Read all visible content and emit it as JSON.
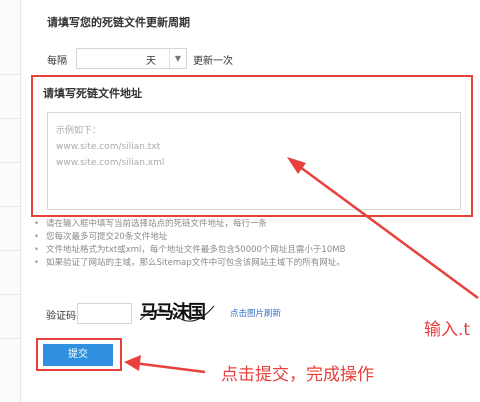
{
  "frequency_section": {
    "title": "请填写您的死链文件更新周期",
    "prefix_label": "每隔",
    "unit_value": "天",
    "suffix_label": "更新一次"
  },
  "address_section": {
    "title": "请填写死链文件地址",
    "placeholder_lines": [
      "示例如下：",
      "www.site.com/silian.txt",
      "www.site.com/silian.xml"
    ]
  },
  "notes": [
    "请在输入框中填写当前选择站点的死链文件地址，每行一条",
    "您每次最多可提交20条文件地址",
    "文件地址格式为txt或xml，每个地址文件最多包含50000个网址且需小于10MB",
    "如果验证了网站的主域，那么Sitemap文件中可包含该网站主域下的所有网址。"
  ],
  "captcha": {
    "label": "验证码",
    "image_text": "马马沫国",
    "refresh_label": "点击图片刷新"
  },
  "submit_label": "提交",
  "annotations": {
    "input_hint": "输入.t",
    "submit_hint": "点击提交，完成操作"
  },
  "colors": {
    "highlight_red": "#e8403b",
    "submit_blue": "#2f8fe0",
    "link_blue": "#2f6ec7"
  }
}
